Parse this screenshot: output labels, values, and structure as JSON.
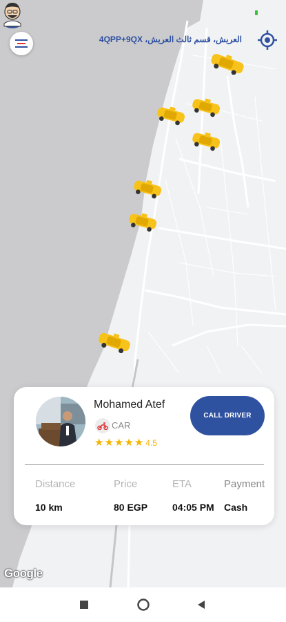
{
  "header": {
    "address": "العريش، قسم ثالث العريش، 4QPP+9QX"
  },
  "map": {
    "attribution": "Google",
    "sea_color": "#cbcbce",
    "land_color": "#f1f2f4",
    "taxi_color": "#f7c21a"
  },
  "driver_card": {
    "name": "Mohamed Atef",
    "vehicle_type": "CAR",
    "rating": "4.5",
    "call_button": "CALL DRIVER",
    "stats": [
      {
        "label": "Distance",
        "value": "10 km"
      },
      {
        "label": "Price",
        "value": "80 EGP"
      },
      {
        "label": "ETA",
        "value": "04:05 PM"
      },
      {
        "label": "Payment",
        "value": "Cash"
      }
    ]
  },
  "colors": {
    "accent": "#2f52a0",
    "star": "#f4b400"
  },
  "icons": {
    "menu": "menu-icon",
    "locate": "my-location-icon",
    "vehicle": "scooter-icon",
    "nav_recents": "square-icon",
    "nav_home": "circle-icon",
    "nav_back": "triangle-back-icon"
  }
}
